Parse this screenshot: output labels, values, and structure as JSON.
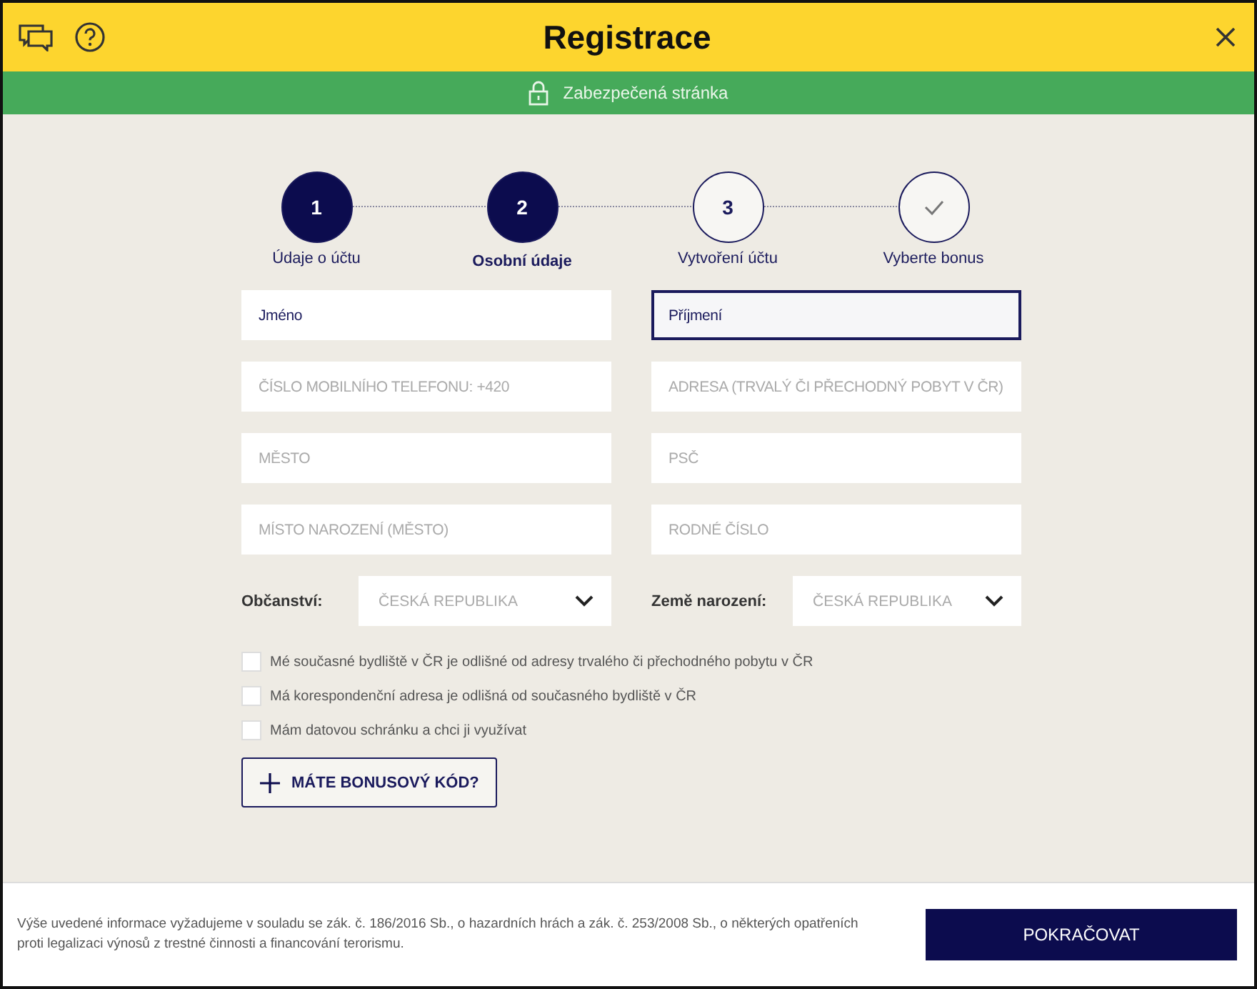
{
  "header": {
    "title": "Registrace"
  },
  "secure_bar": {
    "text": "Zabezpečená stránka"
  },
  "steps": [
    {
      "number": "1",
      "label": "Údaje o účtu",
      "kind": "number",
      "filled": true,
      "selected": false
    },
    {
      "number": "2",
      "label": "Osobní údaje",
      "kind": "number",
      "filled": true,
      "selected": true
    },
    {
      "number": "3",
      "label": "Vytvoření účtu",
      "kind": "number",
      "filled": false,
      "selected": false
    },
    {
      "label": "Vyberte bonus",
      "kind": "check",
      "filled": false,
      "selected": false
    }
  ],
  "fields": [
    {
      "kind": "text",
      "value": "Jméno",
      "focused": false
    },
    {
      "kind": "text",
      "value": "Příjmení",
      "focused": true
    },
    {
      "kind": "text",
      "placeholder": "ČÍSLO MOBILNÍHO TELEFONU: +420",
      "focused": false
    },
    {
      "kind": "text",
      "placeholder": "ADRESA (TRVALÝ ČI PŘECHODNÝ POBYT V ČR)",
      "focused": false
    },
    {
      "kind": "text",
      "placeholder": "MĚSTO",
      "focused": false
    },
    {
      "kind": "text",
      "placeholder": "PSČ",
      "focused": false
    },
    {
      "kind": "text",
      "placeholder": "MÍSTO NAROZENÍ (MĚSTO)",
      "focused": false
    },
    {
      "kind": "text",
      "placeholder": "RODNÉ ČÍSLO",
      "focused": false
    },
    {
      "kind": "select",
      "label": "Občanství:",
      "value": "ČESKÁ REPUBLIKA",
      "focused": false
    },
    {
      "kind": "select",
      "label": "Země narození:",
      "value": "ČESKÁ REPUBLIKA",
      "focused": false
    }
  ],
  "checkboxes": [
    {
      "label": "Mé současné bydliště v ČR je odlišné od adresy trvalého či přechodného pobytu v ČR",
      "checked": false
    },
    {
      "label": "Má korespondenční adresa je odlišná od současného bydliště v ČR",
      "checked": false
    },
    {
      "label": "Mám datovou schránku a chci ji využívat",
      "checked": false
    }
  ],
  "bonus_button": {
    "label": "MÁTE BONUSOVÝ KÓD?"
  },
  "footer": {
    "notice": "Výše uvedené informace vyžadujeme v souladu se zák. č. 186/2016 Sb., o hazardních hrách a zák. č. 253/2008 Sb., o některých opatřeních proti legalizaci výnosů z trestné činnosti a financování terorismu.",
    "button": "POKRAČOVAT"
  }
}
